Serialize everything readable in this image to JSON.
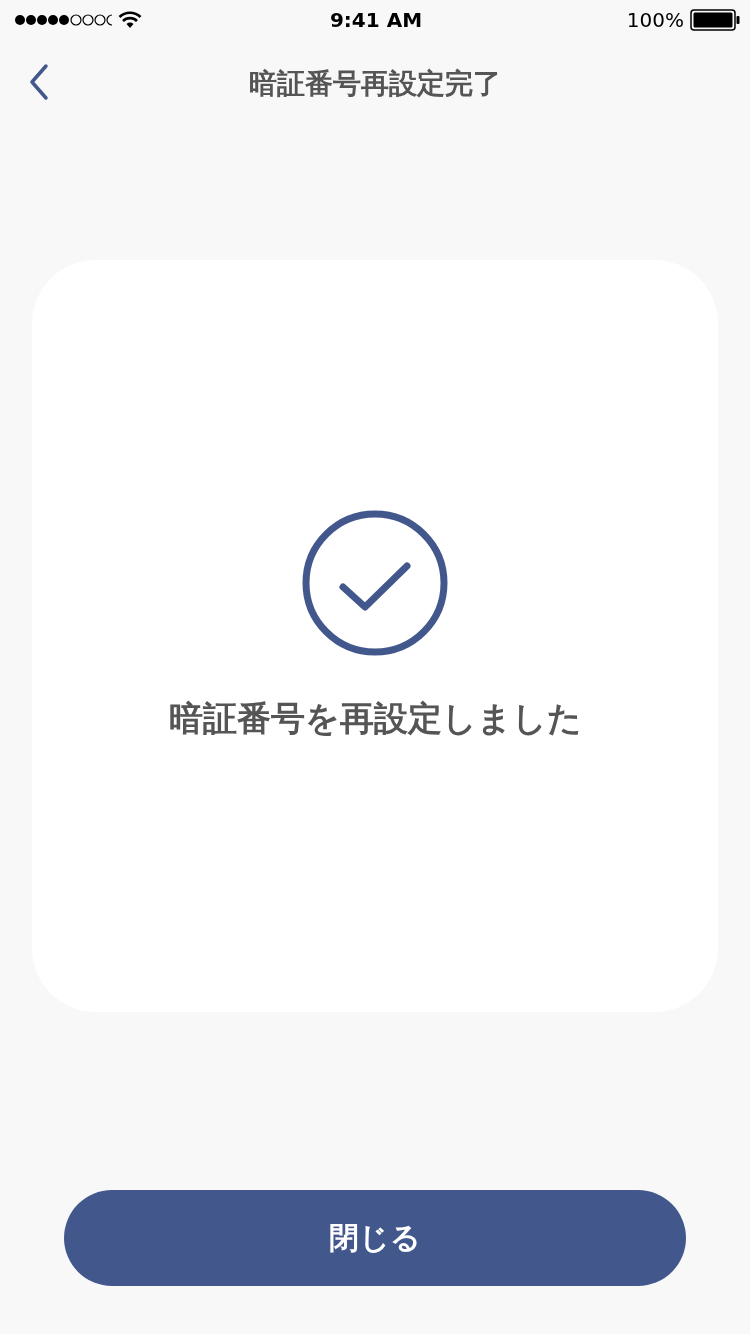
{
  "status_bar": {
    "time": "9:41 AM",
    "battery": "100%"
  },
  "nav": {
    "title": "暗証番号再設定完了"
  },
  "card": {
    "message": "暗証番号を再設定しました"
  },
  "button": {
    "label": "閉じる"
  }
}
